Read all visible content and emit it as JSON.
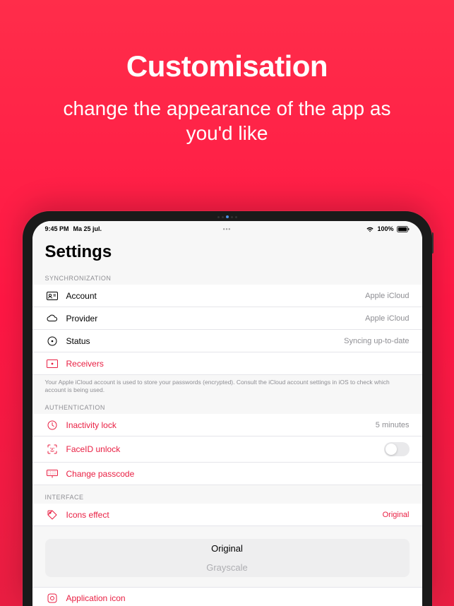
{
  "hero": {
    "title": "Customisation",
    "subtitle": "change the appearance of the app as you'd like"
  },
  "status": {
    "time": "9:45 PM",
    "date": "Ma 25 jul.",
    "center": "•••",
    "battery": "100%"
  },
  "page_title": "Settings",
  "sections": {
    "sync": {
      "header": "SYNCHRONIZATION",
      "account": {
        "label": "Account",
        "value": "Apple iCloud"
      },
      "provider": {
        "label": "Provider",
        "value": "Apple iCloud"
      },
      "status": {
        "label": "Status",
        "value": "Syncing up-to-date"
      },
      "receivers": {
        "label": "Receivers"
      },
      "footer": "Your Apple iCloud account is used to store your passwords (encrypted). Consult the iCloud account settings in iOS to check which account is being used."
    },
    "auth": {
      "header": "AUTHENTICATION",
      "inactivity": {
        "label": "Inactivity lock",
        "value": "5 minutes"
      },
      "faceid": {
        "label": "FaceID unlock"
      },
      "passcode": {
        "label": "Change passcode"
      }
    },
    "interface": {
      "header": "INTERFACE",
      "icons_effect": {
        "label": "Icons effect",
        "value": "Original"
      },
      "picker": {
        "selected": "Original",
        "option2": "Grayscale"
      },
      "app_icon": {
        "label": "Application icon"
      }
    }
  }
}
